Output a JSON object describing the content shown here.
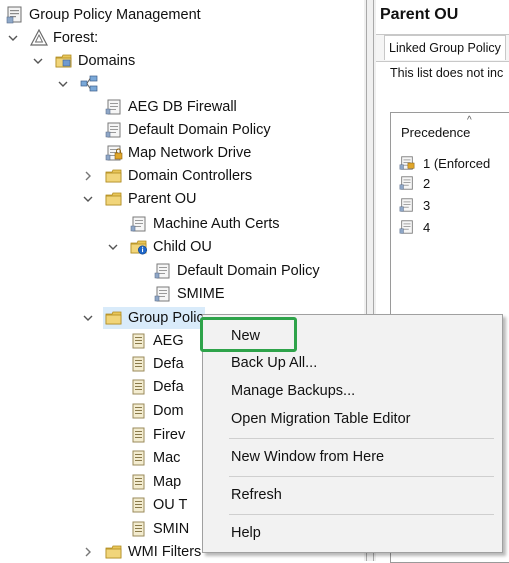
{
  "tree": {
    "root": "Group Policy Management",
    "forest": "Forest:",
    "domains": "Domains",
    "items": [
      "AEG DB Firewall",
      "Default Domain Policy",
      "Map Network Drive",
      "Domain Controllers",
      "Parent OU",
      "Machine Auth Certs",
      "Child OU",
      "Default Domain Policy",
      "SMIME",
      "Group Policy Objects"
    ],
    "gpo_children": [
      "AEG",
      "Defa",
      "Defa",
      "Dom",
      "Firev",
      "Mac",
      "Map",
      "OU T",
      "SMIN"
    ],
    "wmi": "WMI Filters"
  },
  "right_pane": {
    "title": "Parent OU",
    "tab": "Linked Group Policy",
    "info": "This list does not inc",
    "column": "Precedence",
    "rows": [
      "1  (Enforced",
      "2",
      "3",
      "4"
    ]
  },
  "context_menu": {
    "items": [
      "New",
      "Back Up All...",
      "Manage Backups...",
      "Open Migration Table Editor",
      "New Window from Here",
      "Refresh",
      "Help"
    ]
  },
  "colors": {
    "highlight": "#2ea34a",
    "selection": "#d9ebfa"
  }
}
